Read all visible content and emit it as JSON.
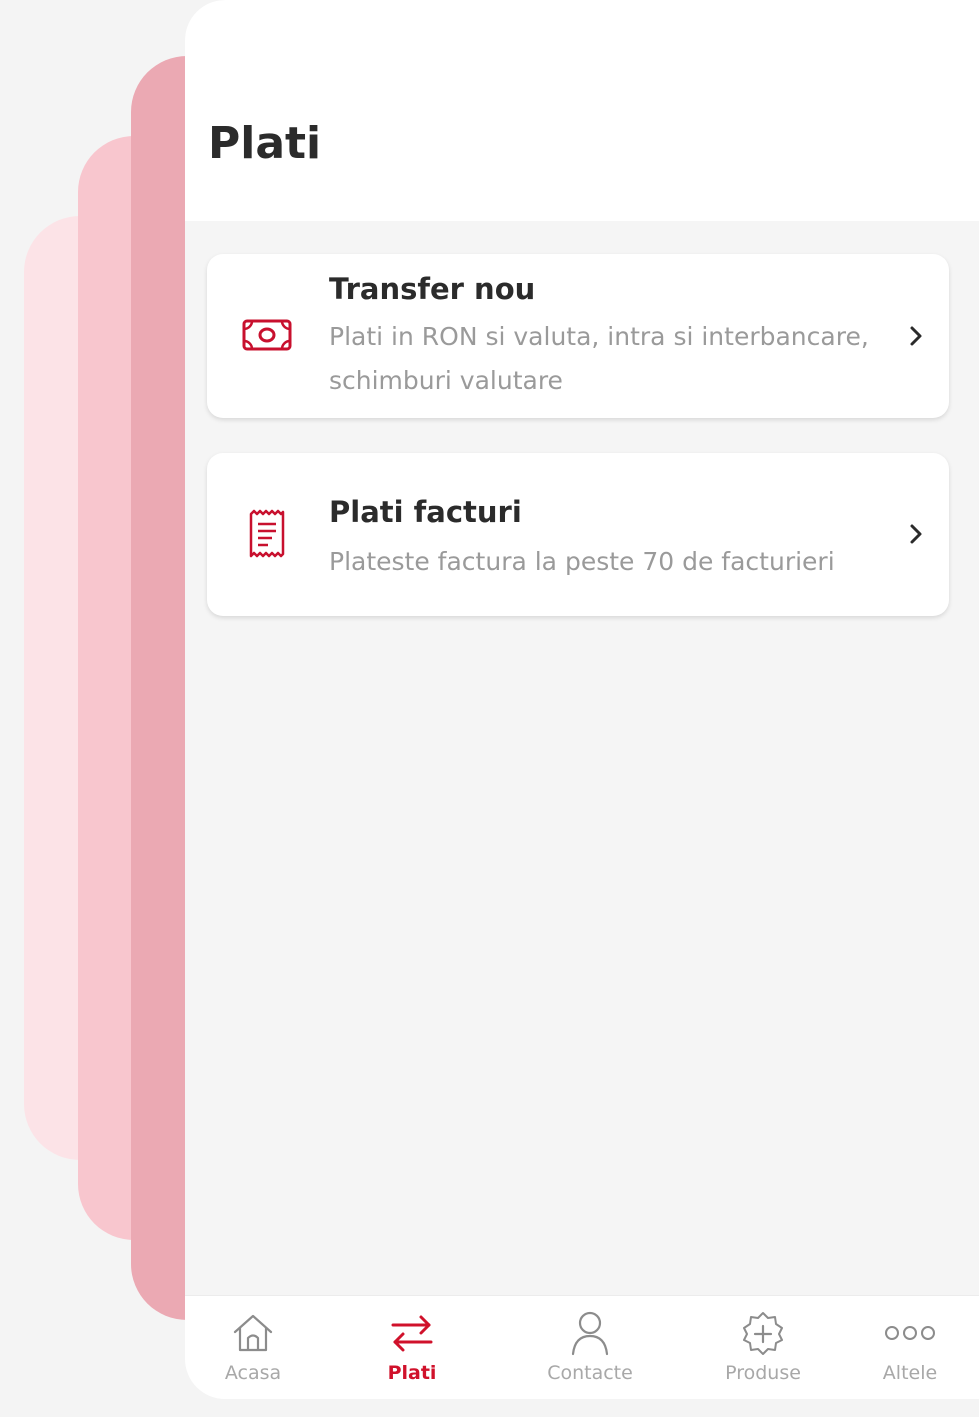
{
  "page": {
    "title": "Plati"
  },
  "cards": [
    {
      "title": "Transfer nou",
      "subtitle": "Plati in RON si valuta, intra si interbancare, schimburi valutare",
      "icon": "banknote-icon"
    },
    {
      "title": "Plati facturi",
      "subtitle": "Plateste factura la peste 70 de facturieri",
      "icon": "receipt-icon"
    }
  ],
  "tabbar": {
    "tabs": [
      {
        "label": "Acasa",
        "icon": "home-icon",
        "active": false
      },
      {
        "label": "Plati",
        "icon": "transfer-arrows-icon",
        "active": true
      },
      {
        "label": "Contacte",
        "icon": "person-icon",
        "active": false
      },
      {
        "label": "Produse",
        "icon": "badge-plus-icon",
        "active": false
      },
      {
        "label": "Altele",
        "icon": "more-dots-icon",
        "active": false
      }
    ]
  },
  "colors": {
    "accent": "#d0112b",
    "background": "#f5f5f5",
    "card": "#ffffff",
    "text_primary": "#2b2b2b",
    "text_secondary": "#9a9a9a",
    "tab_inactive": "#a8a8a8"
  }
}
